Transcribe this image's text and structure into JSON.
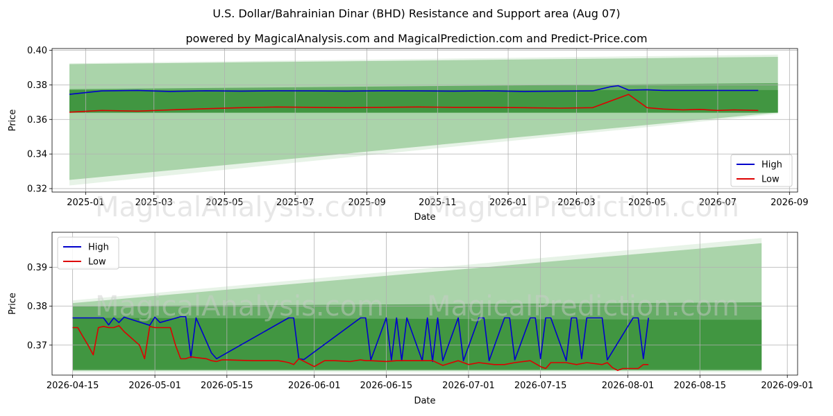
{
  "title": "U.S. Dollar/Bahrainian Dinar (BHD) Resistance and Support area (Aug 07)",
  "subtitle": "powered by MagicalAnalysis.com and MagicalPrediction.com and Predict-Price.com",
  "watermarks": [
    "MagicalAnalysis.com",
    "MagicalPrediction.com"
  ],
  "colors": {
    "high": "#0000cc",
    "low": "#dd0000",
    "band_light": "#3a9a3a",
    "band_dark": "#2e8b2e"
  },
  "chart_data": [
    {
      "type": "line",
      "xlabel": "Date",
      "ylabel": "Price",
      "ylim": [
        0.318,
        0.401
      ],
      "xlim": [
        "2024-12-03",
        "2026-09-08"
      ],
      "grid": true,
      "legend_position": "lower-right",
      "x_ticks": [
        "2025-01",
        "2025-03",
        "2025-05",
        "2025-07",
        "2025-09",
        "2025-11",
        "2026-01",
        "2026-03",
        "2026-05",
        "2026-07",
        "2026-09"
      ],
      "y_ticks": [
        "0.32",
        "0.34",
        "0.36",
        "0.38",
        "0.40"
      ],
      "series": [
        {
          "name": "High",
          "color": "#0000cc",
          "x": [
            "2024-12-18",
            "2025-01-15",
            "2025-02-15",
            "2025-03-15",
            "2025-04-15",
            "2025-05-15",
            "2025-06-15",
            "2025-07-15",
            "2025-08-15",
            "2025-09-15",
            "2025-10-15",
            "2025-11-15",
            "2025-12-15",
            "2026-01-15",
            "2026-02-15",
            "2026-03-15",
            "2026-03-31",
            "2026-04-06",
            "2026-04-15",
            "2026-05-01",
            "2026-05-15",
            "2026-06-01",
            "2026-06-15",
            "2026-07-01",
            "2026-07-15",
            "2026-08-05"
          ],
          "y": [
            0.3745,
            0.3765,
            0.3768,
            0.3762,
            0.3766,
            0.3764,
            0.3766,
            0.3765,
            0.3764,
            0.3766,
            0.3765,
            0.3764,
            0.3766,
            0.3762,
            0.3764,
            0.3765,
            0.379,
            0.3795,
            0.377,
            0.3772,
            0.3768,
            0.3768,
            0.3768,
            0.3768,
            0.3768,
            0.3768
          ]
        },
        {
          "name": "Low",
          "color": "#dd0000",
          "x": [
            "2024-12-18",
            "2025-01-15",
            "2025-02-15",
            "2025-03-15",
            "2025-04-15",
            "2025-05-15",
            "2025-06-15",
            "2025-07-15",
            "2025-08-15",
            "2025-09-15",
            "2025-10-15",
            "2025-11-15",
            "2025-12-15",
            "2026-01-15",
            "2026-02-15",
            "2026-03-15",
            "2026-04-15",
            "2026-05-01",
            "2026-05-15",
            "2026-06-01",
            "2026-06-15",
            "2026-07-01",
            "2026-07-15",
            "2026-08-05"
          ],
          "y": [
            0.3642,
            0.3652,
            0.3648,
            0.3655,
            0.3662,
            0.3668,
            0.3672,
            0.367,
            0.3668,
            0.367,
            0.3672,
            0.367,
            0.367,
            0.3668,
            0.3665,
            0.3668,
            0.3745,
            0.3668,
            0.366,
            0.3655,
            0.3658,
            0.3652,
            0.3655,
            0.3652
          ]
        }
      ]
    },
    {
      "type": "line",
      "xlabel": "Date",
      "ylabel": "Price",
      "ylim": [
        0.3623,
        0.399
      ],
      "xlim": [
        "2026-04-11",
        "2026-09-03"
      ],
      "grid": true,
      "legend_position": "upper-left",
      "x_ticks": [
        "2026-04-15",
        "2026-05-01",
        "2026-05-15",
        "2026-06-01",
        "2026-06-15",
        "2026-07-01",
        "2026-07-15",
        "2026-08-01",
        "2026-08-15",
        "2026-09-01"
      ],
      "y_ticks": [
        "0.37",
        "0.38",
        "0.39"
      ],
      "series": [
        {
          "name": "High",
          "color": "#0000cc",
          "x": [
            "2026-04-15",
            "2026-04-21",
            "2026-04-22",
            "2026-04-23",
            "2026-04-24",
            "2026-04-25",
            "2026-04-29",
            "2026-04-30",
            "2026-05-01",
            "2026-05-02",
            "2026-05-06",
            "2026-05-07",
            "2026-05-08",
            "2026-05-09",
            "2026-05-12",
            "2026-05-13",
            "2026-05-27",
            "2026-05-28",
            "2026-05-29",
            "2026-05-30",
            "2026-06-10",
            "2026-06-11",
            "2026-06-12",
            "2026-06-15",
            "2026-06-16",
            "2026-06-17",
            "2026-06-18",
            "2026-06-19",
            "2026-06-22",
            "2026-06-23",
            "2026-06-24",
            "2026-06-25",
            "2026-06-26",
            "2026-06-29",
            "2026-06-30",
            "2026-07-03",
            "2026-07-04",
            "2026-07-05",
            "2026-07-08",
            "2026-07-09",
            "2026-07-10",
            "2026-07-13",
            "2026-07-14",
            "2026-07-15",
            "2026-07-16",
            "2026-07-17",
            "2026-07-20",
            "2026-07-21",
            "2026-07-22",
            "2026-07-23",
            "2026-07-24",
            "2026-07-27",
            "2026-07-28",
            "2026-08-02",
            "2026-08-03",
            "2026-08-04",
            "2026-08-05"
          ],
          "y": [
            0.377,
            0.377,
            0.3752,
            0.377,
            0.3758,
            0.3772,
            0.3755,
            0.3751,
            0.3772,
            0.3758,
            0.3773,
            0.3773,
            0.3668,
            0.377,
            0.368,
            0.3665,
            0.377,
            0.377,
            0.3665,
            0.3663,
            0.377,
            0.377,
            0.3662,
            0.377,
            0.3662,
            0.377,
            0.366,
            0.377,
            0.366,
            0.377,
            0.3658,
            0.377,
            0.366,
            0.377,
            0.366,
            0.377,
            0.377,
            0.366,
            0.377,
            0.377,
            0.3662,
            0.377,
            0.377,
            0.3665,
            0.377,
            0.377,
            0.366,
            0.377,
            0.377,
            0.3665,
            0.377,
            0.377,
            0.3662,
            0.377,
            0.377,
            0.3665,
            0.377
          ]
        },
        {
          "name": "Low",
          "color": "#dd0000",
          "x": [
            "2026-04-15",
            "2026-04-16",
            "2026-04-17",
            "2026-04-18",
            "2026-04-19",
            "2026-04-20",
            "2026-04-21",
            "2026-04-22",
            "2026-04-23",
            "2026-04-24",
            "2026-04-25",
            "2026-04-28",
            "2026-04-29",
            "2026-04-30",
            "2026-05-01",
            "2026-05-04",
            "2026-05-05",
            "2026-05-06",
            "2026-05-07",
            "2026-05-08",
            "2026-05-09",
            "2026-05-11",
            "2026-05-12",
            "2026-05-13",
            "2026-05-14",
            "2026-05-15",
            "2026-05-20",
            "2026-05-22",
            "2026-05-25",
            "2026-05-26",
            "2026-05-27",
            "2026-05-28",
            "2026-05-29",
            "2026-06-01",
            "2026-06-03",
            "2026-06-05",
            "2026-06-08",
            "2026-06-10",
            "2026-06-11",
            "2026-06-12",
            "2026-06-15",
            "2026-06-17",
            "2026-06-19",
            "2026-06-22",
            "2026-06-24",
            "2026-06-26",
            "2026-06-29",
            "2026-07-01",
            "2026-07-03",
            "2026-07-06",
            "2026-07-08",
            "2026-07-10",
            "2026-07-13",
            "2026-07-15",
            "2026-07-16",
            "2026-07-17",
            "2026-07-20",
            "2026-07-22",
            "2026-07-24",
            "2026-07-27",
            "2026-07-28",
            "2026-07-29",
            "2026-07-30",
            "2026-07-31",
            "2026-08-03",
            "2026-08-04",
            "2026-08-05"
          ],
          "y": [
            0.3745,
            0.3745,
            0.3722,
            0.37,
            0.3675,
            0.3745,
            0.3748,
            0.3745,
            0.3745,
            0.375,
            0.3735,
            0.37,
            0.3665,
            0.3748,
            0.3745,
            0.3745,
            0.37,
            0.3665,
            0.3665,
            0.367,
            0.3668,
            0.3665,
            0.366,
            0.3658,
            0.3662,
            0.3662,
            0.366,
            0.366,
            0.366,
            0.3658,
            0.3655,
            0.365,
            0.3665,
            0.3645,
            0.366,
            0.366,
            0.3658,
            0.3662,
            0.366,
            0.366,
            0.3658,
            0.366,
            0.366,
            0.366,
            0.366,
            0.3648,
            0.366,
            0.365,
            0.3655,
            0.365,
            0.365,
            0.3655,
            0.366,
            0.3645,
            0.364,
            0.3655,
            0.3655,
            0.365,
            0.3655,
            0.365,
            0.3655,
            0.3642,
            0.3635,
            0.364,
            0.364,
            0.365,
            0.365
          ]
        }
      ]
    }
  ],
  "bands": [
    {
      "chart": 0,
      "layers": [
        {
          "x": [
            "2024-12-18",
            "2026-08-22"
          ],
          "upper": [
            0.3925,
            0.3975
          ],
          "lower": [
            0.3218,
            0.3632
          ],
          "opacity": 0.12
        },
        {
          "x": [
            "2024-12-18",
            "2026-08-22"
          ],
          "upper": [
            0.392,
            0.3962
          ],
          "lower": [
            0.325,
            0.364
          ],
          "opacity": 0.35
        },
        {
          "x": [
            "2024-12-18",
            "2026-08-22"
          ],
          "upper": [
            0.3775,
            0.381
          ],
          "lower": [
            0.3638,
            0.3638
          ],
          "opacity": 0.55
        },
        {
          "x": [
            "2024-12-18",
            "2026-08-22"
          ],
          "upper": [
            0.377,
            0.377
          ],
          "lower": [
            0.364,
            0.364
          ],
          "opacity": 0.65
        }
      ]
    },
    {
      "chart": 1,
      "layers": [
        {
          "x": [
            "2026-04-15",
            "2026-08-27"
          ],
          "upper": [
            0.3815,
            0.3975
          ],
          "lower": [
            0.363,
            0.363
          ],
          "opacity": 0.12
        },
        {
          "x": [
            "2026-04-15",
            "2026-08-27"
          ],
          "upper": [
            0.3808,
            0.3962
          ],
          "lower": [
            0.3635,
            0.3635
          ],
          "opacity": 0.35
        },
        {
          "x": [
            "2026-04-15",
            "2026-08-27"
          ],
          "upper": [
            0.38,
            0.381
          ],
          "lower": [
            0.3635,
            0.3635
          ],
          "opacity": 0.55
        },
        {
          "x": [
            "2026-04-15",
            "2026-08-27"
          ],
          "upper": [
            0.377,
            0.3765
          ],
          "lower": [
            0.3638,
            0.3638
          ],
          "opacity": 0.65
        }
      ]
    }
  ]
}
